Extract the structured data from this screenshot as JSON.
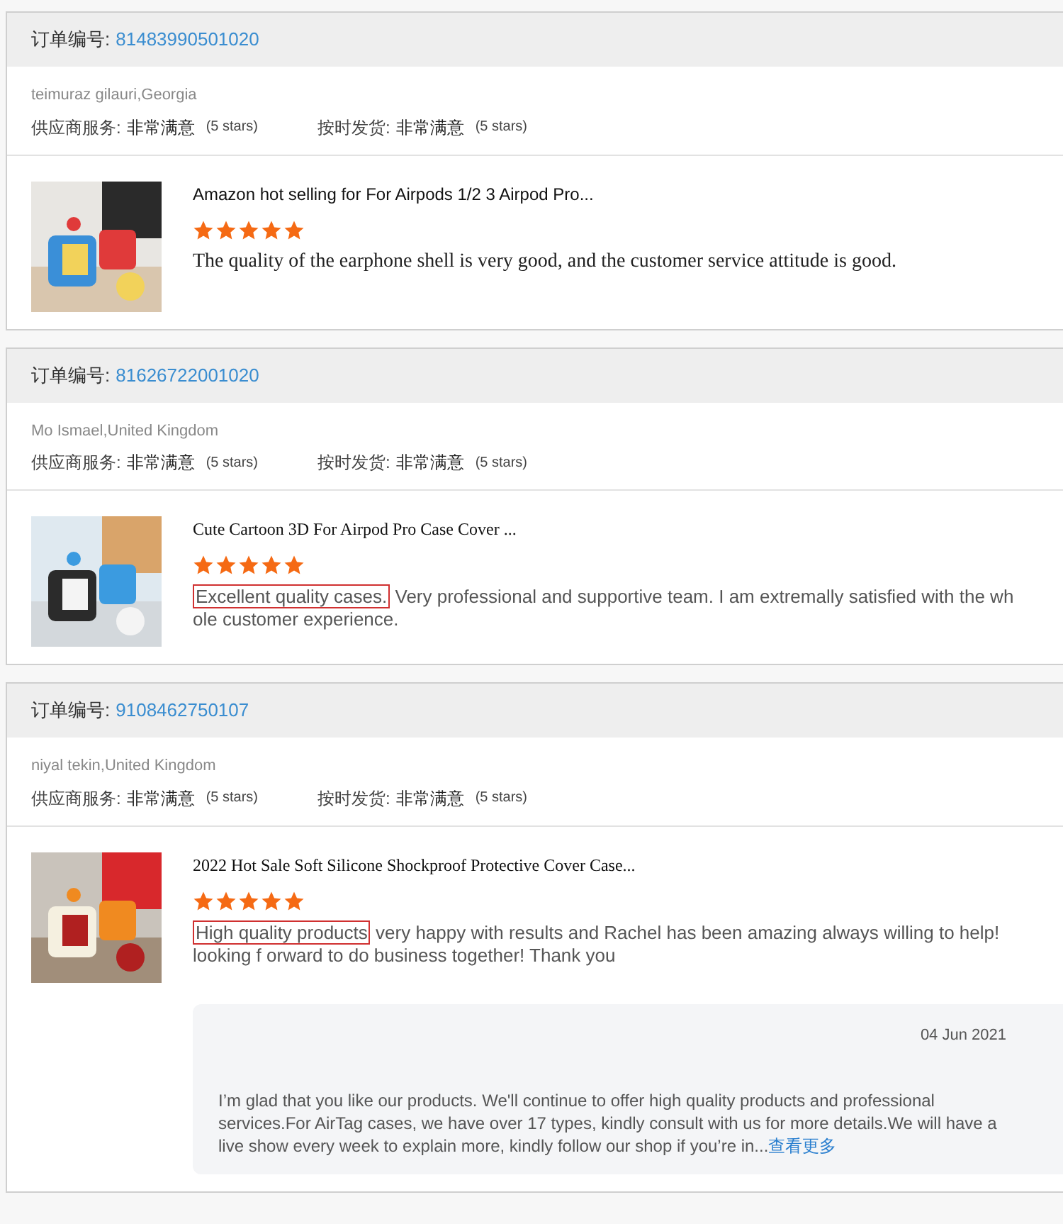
{
  "orders": [
    {
      "order_label": "订单编号:",
      "order_number": "81483990501020",
      "buyer": "teimuraz gilauri,Georgia",
      "ratings": [
        {
          "label": "供应商服务:",
          "value": "非常满意",
          "stars_text": "(5 stars)"
        },
        {
          "label": "按时发货:",
          "value": "非常满意",
          "stars_text": "(5 stars)"
        }
      ],
      "product": {
        "kind": "picture",
        "title": "Amazon hot selling for For Airpods 1/2 3 Airpod Pro...",
        "stars": 5,
        "review": "The quality of the earphone shell is very good, and the customer service attitude is good."
      }
    },
    {
      "order_label": "订单编号:",
      "order_number": "81626722001020",
      "buyer": "Mo Ismael,United Kingdom",
      "ratings": [
        {
          "label": "供应商服务:",
          "value": "非常满意",
          "stars_text": "(5 stars)"
        },
        {
          "label": "按时发货:",
          "value": "非常满意",
          "stars_text": "(5 stars)"
        }
      ],
      "product": {
        "kind": "picture",
        "title": "Cute Cartoon 3D For Airpod Pro Case Cover ...",
        "stars": 5,
        "highlight": "Excellent quality cases.",
        "review": "Very professional and supportive team. I am extremally satisfied with the wh ole customer experience."
      }
    },
    {
      "order_label": "订单编号:",
      "order_number": "9108462750107",
      "buyer": "niyal tekin,United Kingdom",
      "ratings": [
        {
          "label": "供应商服务:",
          "value": "非常满意",
          "stars_text": "(5 stars)"
        },
        {
          "label": "按时发货:",
          "value": "非常满意",
          "stars_text": "(5 stars)"
        }
      ],
      "product": {
        "kind": "picture",
        "title": "2022 Hot Sale Soft Silicone Shockproof Protective Cover Case...",
        "stars": 5,
        "highlight": "High quality products",
        "review": "very happy with results and Rachel has been amazing always willing to help! looking f orward to do business together! Thank you"
      },
      "reply": {
        "date": "04 Jun 2021",
        "text": "I’m glad that you like our products. We'll continue to offer high quality products and professional services.For AirTag cases, we have over 17 types, kindly consult with us for more details.We will have a live show every week to explain more, kindly follow our shop if you’re in...",
        "more_link": "查看更多"
      }
    }
  ]
}
